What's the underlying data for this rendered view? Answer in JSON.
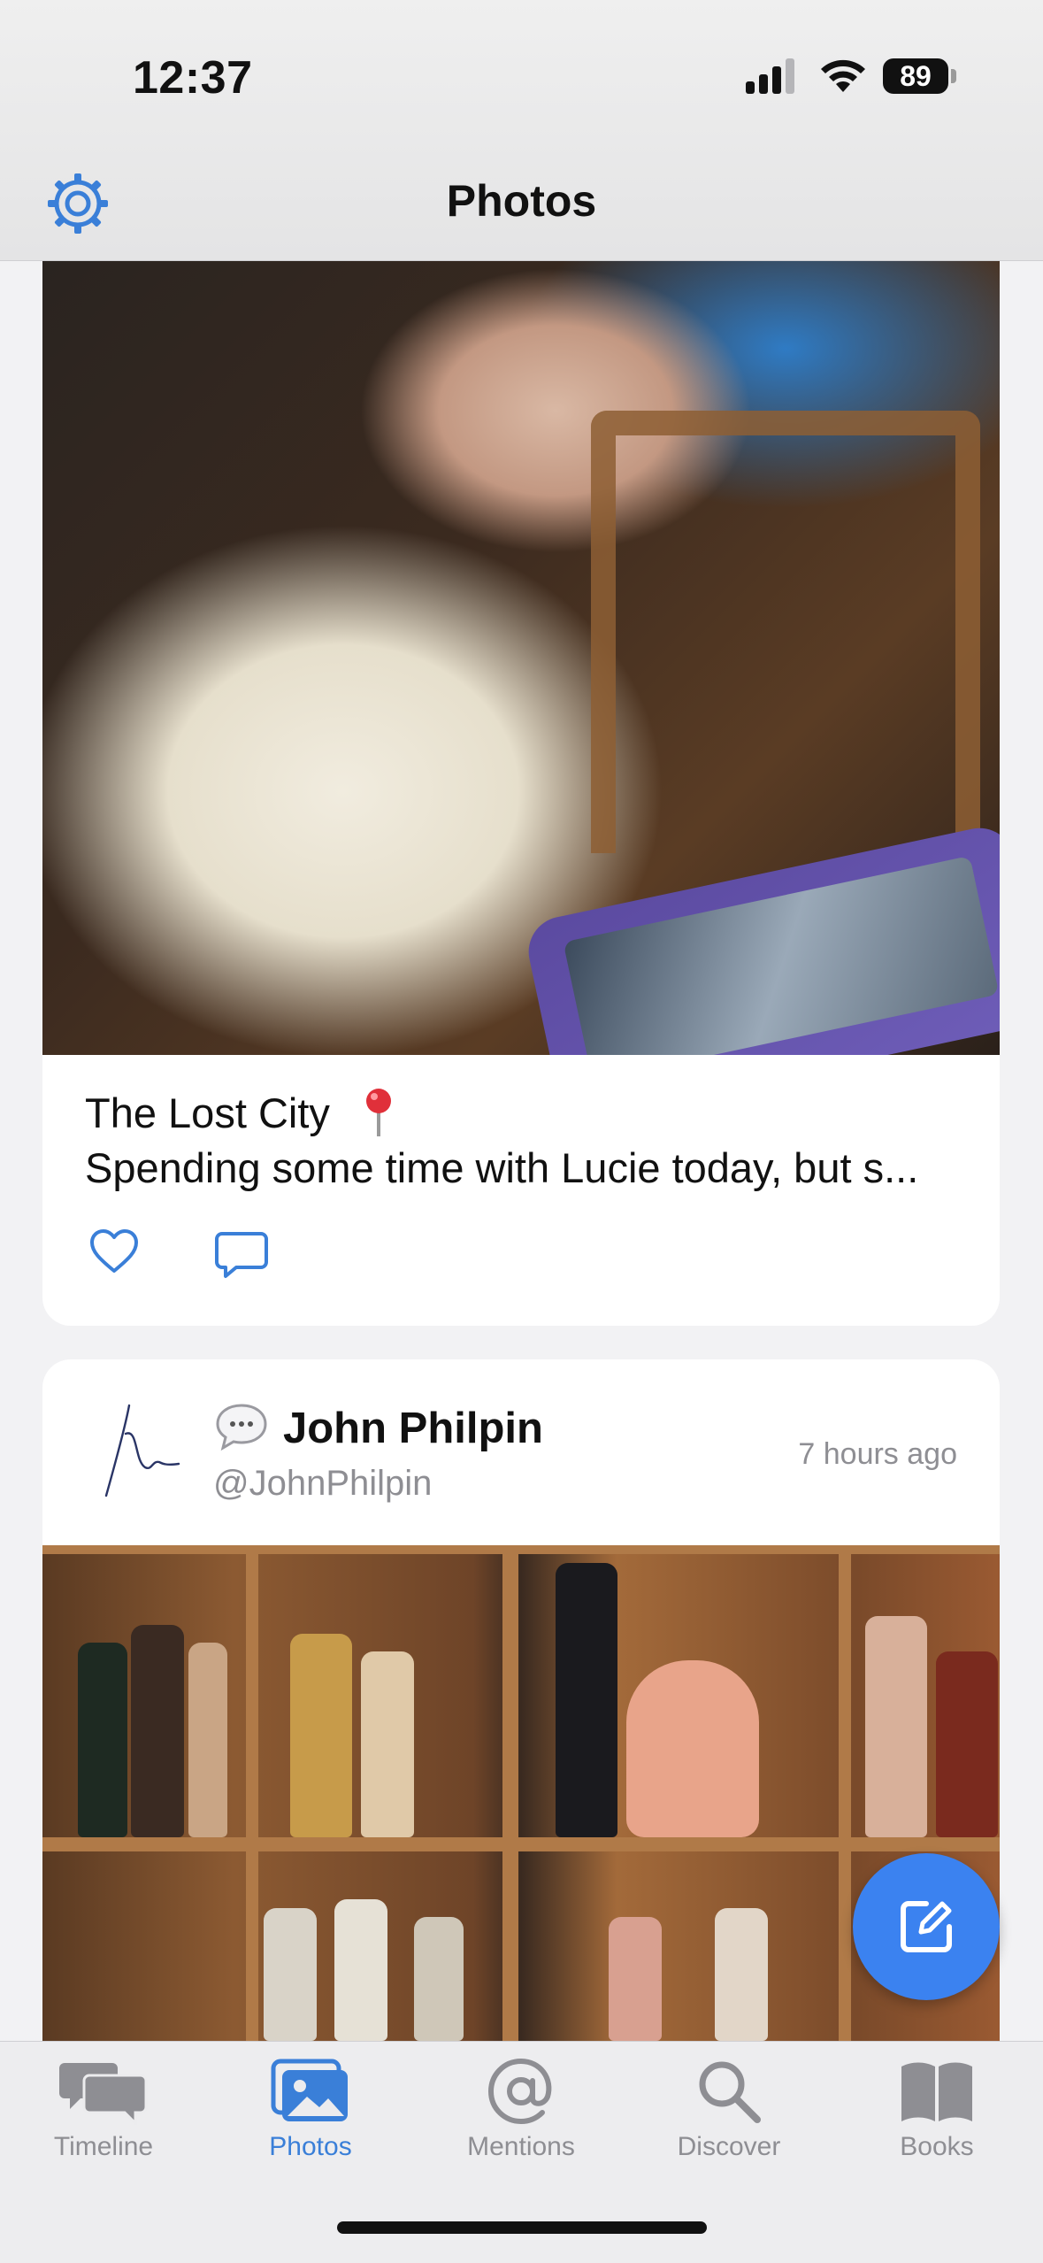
{
  "status_bar": {
    "time": "12:37",
    "battery": "89"
  },
  "nav": {
    "title": "Photos",
    "settings_icon": "gear-icon"
  },
  "posts": [
    {
      "title": "The Lost City",
      "text": "Spending some time with Lucie today, but s...",
      "actions": [
        "heart-icon",
        "reply-icon"
      ]
    },
    {
      "author": "John Philpin",
      "handle": "@JohnPhilpin",
      "time": "7 hours ago"
    }
  ],
  "fab": {
    "icon": "compose-icon"
  },
  "tabs": [
    {
      "label": "Timeline",
      "icon": "chat-bubbles-icon",
      "active": false
    },
    {
      "label": "Photos",
      "icon": "photos-icon",
      "active": true
    },
    {
      "label": "Mentions",
      "icon": "at-icon",
      "active": false
    },
    {
      "label": "Discover",
      "icon": "search-icon",
      "active": false
    },
    {
      "label": "Books",
      "icon": "book-icon",
      "active": false
    }
  ],
  "colors": {
    "accent": "#3a7fd8",
    "fab": "#3b82f0",
    "inactive": "#8e8e93"
  }
}
